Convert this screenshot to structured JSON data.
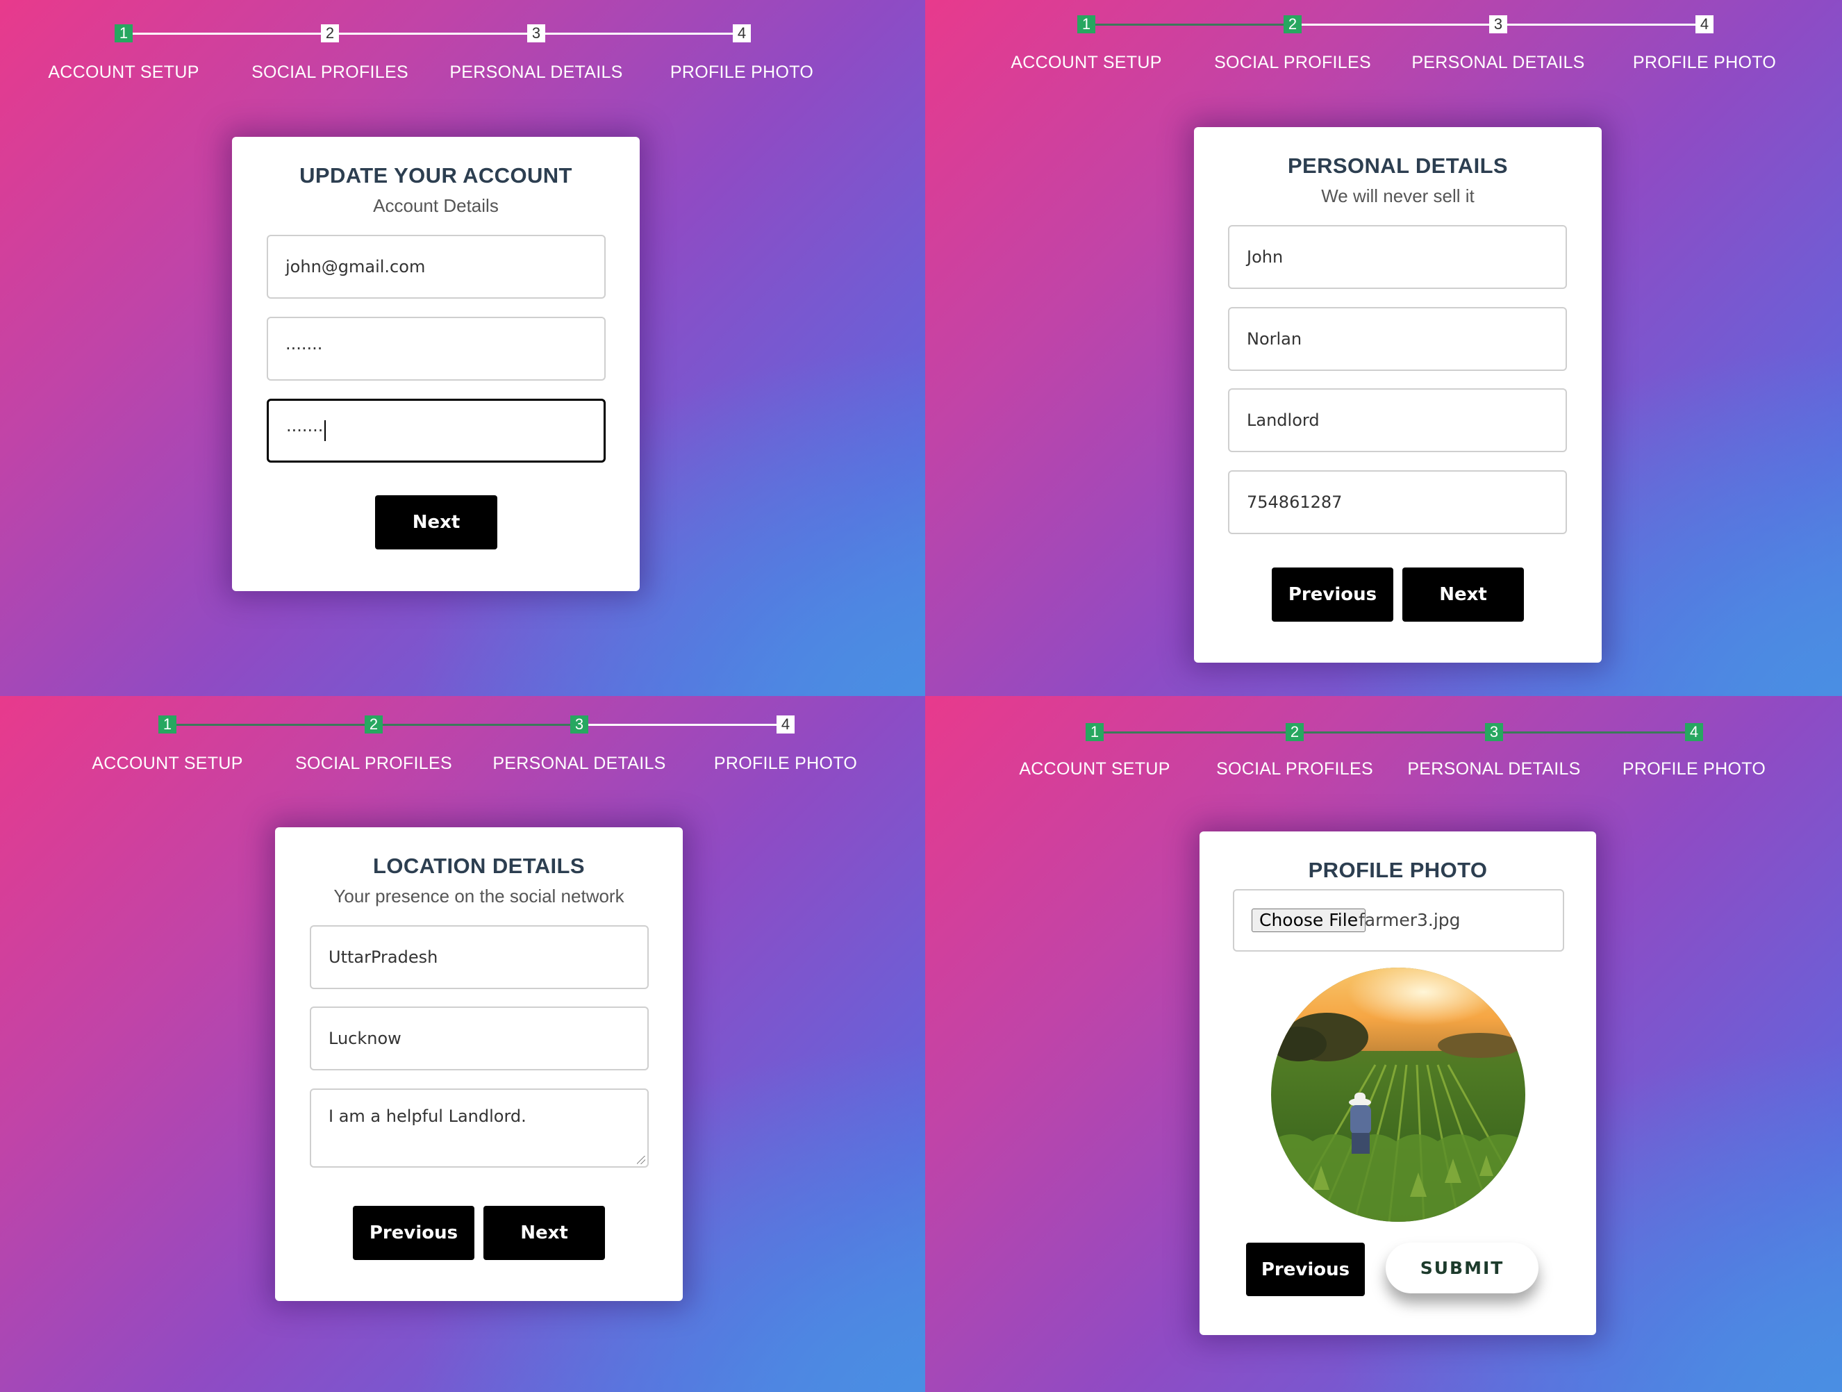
{
  "steps": [
    "ACCOUNT SETUP",
    "SOCIAL PROFILES",
    "PERSONAL DETAILS",
    "PROFILE PHOTO"
  ],
  "step_numbers": [
    "1",
    "2",
    "3",
    "4"
  ],
  "panels": {
    "account": {
      "title": "UPDATE YOUR ACCOUNT",
      "subtitle": "Account Details",
      "email": "john@gmail.com",
      "password": "·······",
      "confirm_password": "·······",
      "next_label": "Next",
      "completed_steps": 1
    },
    "personal": {
      "title": "PERSONAL DETAILS",
      "subtitle": "We will never sell it",
      "first_name": "John",
      "last_name": "Norlan",
      "occupation": "Landlord",
      "phone": "754861287",
      "previous_label": "Previous",
      "next_label": "Next",
      "completed_steps": 2
    },
    "location": {
      "title": "LOCATION DETAILS",
      "subtitle": "Your presence on the social network",
      "state": "UttarPradesh",
      "city": "Lucknow",
      "bio": "I am a helpful Landlord.",
      "previous_label": "Previous",
      "next_label": "Next",
      "completed_steps": 3
    },
    "photo": {
      "title": "PROFILE PHOTO",
      "choose_file_label": "Choose File",
      "file_name": "farmer3.jpg",
      "previous_label": "Previous",
      "submit_label": "SUBMIT",
      "completed_steps": 4
    }
  },
  "colors": {
    "step_done": "#27a760",
    "track_done": "#3b7a5a",
    "gradient_start": "#e83a8c",
    "gradient_end": "#4e86e2",
    "button": "#000000"
  }
}
